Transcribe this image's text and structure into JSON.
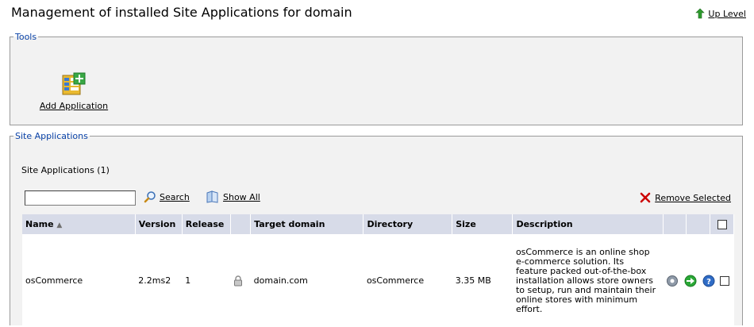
{
  "header": {
    "title": "Management of installed Site Applications for domain",
    "up_level": "Up Level"
  },
  "tools": {
    "legend": "Tools",
    "add_application": "Add Application"
  },
  "site_apps": {
    "legend": "Site Applications",
    "count_label": "Site Applications (1)",
    "search": {
      "value": "",
      "placeholder": ""
    },
    "search_label": "Search",
    "show_all_label": "Show All",
    "remove_selected_label": "Remove Selected",
    "columns": {
      "name": "Name",
      "version": "Version",
      "release": "Release",
      "target_domain": "Target domain",
      "directory": "Directory",
      "size": "Size",
      "description": "Description"
    },
    "rows": [
      {
        "name": "osCommerce",
        "version": "2.2ms2",
        "release": "1",
        "target_domain": "domain.com",
        "directory": "osCommerce",
        "size": "3.35 MB",
        "description": "osCommerce is an online shop e-commerce solution. Its feature packed out-of-the-box installation allows store owners to setup, run and maintain their online stores with minimum effort."
      }
    ]
  },
  "colors": {
    "legend": "#0b43a8",
    "header_bg": "#d7dbe8",
    "panel_bg": "#f2f2f2",
    "remove_x": "#cc0000",
    "up_arrow": "#2e9a2e"
  }
}
